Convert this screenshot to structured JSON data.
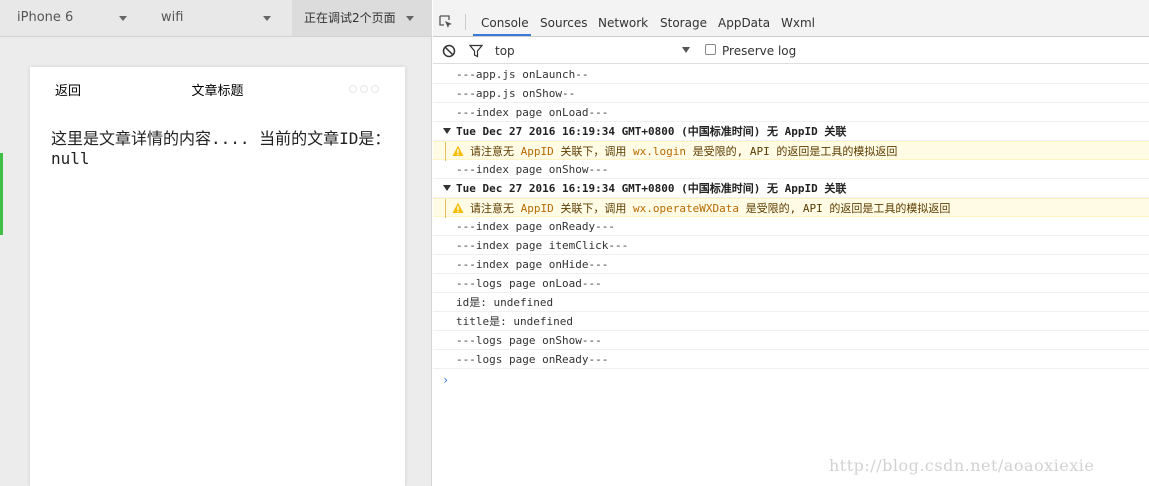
{
  "simulator": {
    "device": "iPhone 6",
    "network": "wifi",
    "debug_pages": "正在调试2个页面",
    "nav": {
      "back_label": "返回",
      "title": "文章标题"
    },
    "content_text": "这里是文章详情的内容.... 当前的文章ID是：null",
    "accent_color": "#3fbf45"
  },
  "devtools": {
    "tabs": [
      "Console",
      "Sources",
      "Network",
      "Storage",
      "AppData",
      "Wxml"
    ],
    "active_tab": "Console",
    "console_toolbar": {
      "context": "top",
      "preserve_log_label": "Preserve log",
      "preserve_log_checked": false
    },
    "logs": [
      {
        "type": "log",
        "text": "---app.js onLaunch--"
      },
      {
        "type": "log",
        "text": "---app.js onShow--"
      },
      {
        "type": "log",
        "text": "---index page onLoad---"
      },
      {
        "type": "group",
        "text": "Tue Dec 27 2016 16:19:34 GMT+0800 (中国标准时间) 无 AppID 关联"
      },
      {
        "type": "warn",
        "pre": "请注意无 ",
        "code1": "AppID",
        "mid": " 关联下，调用 ",
        "code2": "wx.login",
        "post": " 是受限的, API 的返回是工具的模拟返回"
      },
      {
        "type": "log",
        "text": "---index page onShow---"
      },
      {
        "type": "group",
        "text": "Tue Dec 27 2016 16:19:34 GMT+0800 (中国标准时间) 无 AppID 关联"
      },
      {
        "type": "warn",
        "pre": "请注意无 ",
        "code1": "AppID",
        "mid": " 关联下，调用 ",
        "code2": "wx.operateWXData",
        "post": " 是受限的, API 的返回是工具的模拟返回"
      },
      {
        "type": "log",
        "text": "---index page onReady---"
      },
      {
        "type": "log",
        "text": "---index page itemClick---"
      },
      {
        "type": "log",
        "text": "---index page onHide---"
      },
      {
        "type": "log",
        "text": "---logs page onLoad---"
      },
      {
        "type": "log",
        "text": "id是: undefined"
      },
      {
        "type": "log",
        "text": "title是: undefined"
      },
      {
        "type": "log",
        "text": "---logs page onShow---"
      },
      {
        "type": "log",
        "text": "---logs page onReady---"
      }
    ],
    "prompt_symbol": "›",
    "accent_color": "#3879d9"
  },
  "watermark": "http://blog.csdn.net/aoaoxiexie"
}
